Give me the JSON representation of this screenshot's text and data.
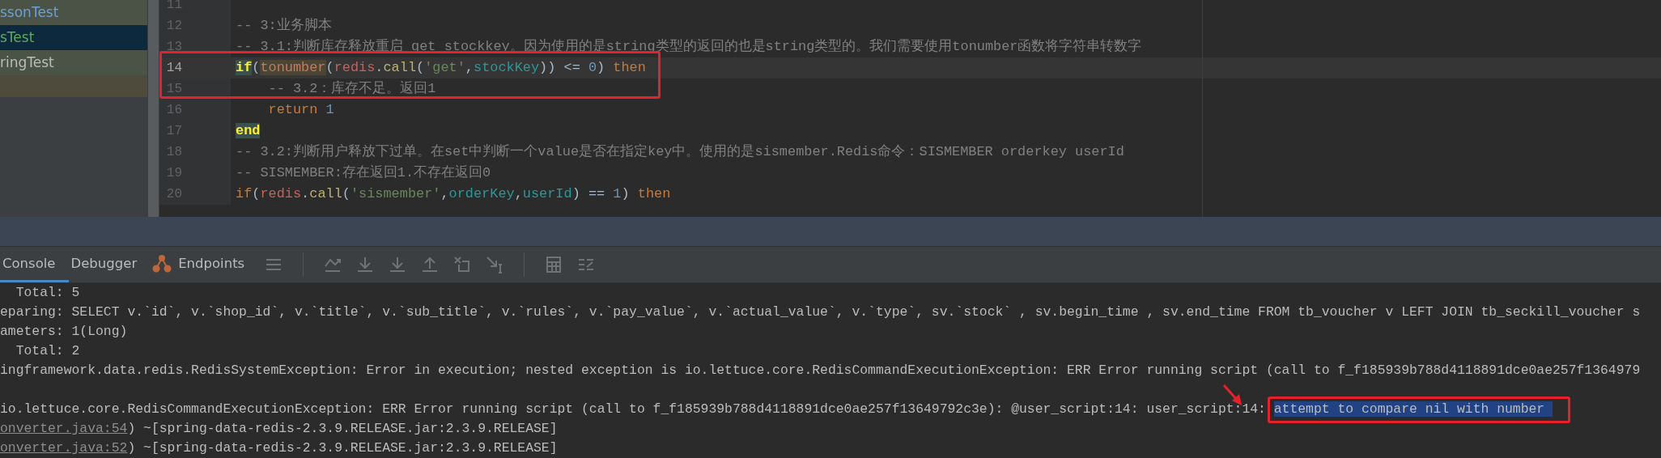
{
  "sidebar": {
    "items": [
      {
        "label": "ssonTest",
        "color": "#6e9fd3",
        "selected": false
      },
      {
        "label": "sTest",
        "color": "#62a85f",
        "selected": true
      },
      {
        "label": "ringTest",
        "color": "#bbbbbb",
        "selected": false
      }
    ]
  },
  "editor": {
    "lines": [
      {
        "number": "11",
        "current": false,
        "boxed": false
      },
      {
        "number": "12",
        "current": false,
        "boxed": false,
        "tokens": [
          {
            "kind": "comment",
            "text": "-- 3:业务脚本"
          }
        ]
      },
      {
        "number": "13",
        "current": false,
        "boxed": false,
        "tokens": [
          {
            "kind": "comment",
            "text": "-- 3.1:判断库存释放重启 get stockkey。因为使用的是string类型的返回的也是string类型的。我们需要使用tonumber函数将字符串转数字"
          }
        ]
      },
      {
        "number": "14",
        "current": true,
        "boxed": true,
        "tokens": [
          {
            "kind": "matched",
            "text": "if"
          },
          {
            "kind": "plain",
            "text": "("
          },
          {
            "kind": "builtin",
            "text": "tonumber"
          },
          {
            "kind": "plain",
            "text": "("
          },
          {
            "kind": "global",
            "text": "redis"
          },
          {
            "kind": "plain",
            "text": "."
          },
          {
            "kind": "method",
            "text": "call"
          },
          {
            "kind": "plain",
            "text": "("
          },
          {
            "kind": "string",
            "text": "'get'"
          },
          {
            "kind": "plain",
            "text": ","
          },
          {
            "kind": "variable",
            "text": "stockKey"
          },
          {
            "kind": "plain",
            "text": ")) <= "
          },
          {
            "kind": "number",
            "text": "0"
          },
          {
            "kind": "plain",
            "text": ") "
          },
          {
            "kind": "keyword",
            "text": "then"
          }
        ]
      },
      {
        "number": "15",
        "current": false,
        "boxed": true,
        "tokens": [
          {
            "kind": "comment",
            "text": "    -- 3.2：库存不足。返回1"
          }
        ]
      },
      {
        "number": "16",
        "current": false,
        "boxed": false,
        "tokens": [
          {
            "kind": "keyword",
            "text": "    return"
          },
          {
            "kind": "number",
            "text": " 1"
          }
        ]
      },
      {
        "number": "17",
        "current": false,
        "boxed": false,
        "tokens": [
          {
            "kind": "matched",
            "text": "end"
          }
        ]
      },
      {
        "number": "18",
        "current": false,
        "boxed": false,
        "tokens": [
          {
            "kind": "comment",
            "text": "-- 3.2:判断用户释放下过单。在set中判断一个value是否在指定key中。使用的是sismember.Redis命令：SISMEMBER orderkey userId"
          }
        ]
      },
      {
        "number": "19",
        "current": false,
        "boxed": false,
        "tokens": [
          {
            "kind": "comment",
            "text": "-- SISMEMBER:存在返回1.不存在返回0"
          }
        ]
      },
      {
        "number": "20",
        "current": false,
        "boxed": false,
        "tokens": [
          {
            "kind": "keyword",
            "text": "if"
          },
          {
            "kind": "plain",
            "text": "("
          },
          {
            "kind": "global",
            "text": "redis"
          },
          {
            "kind": "plain",
            "text": "."
          },
          {
            "kind": "method",
            "text": "call"
          },
          {
            "kind": "plain",
            "text": "("
          },
          {
            "kind": "string",
            "text": "'sismember'"
          },
          {
            "kind": "plain",
            "text": ","
          },
          {
            "kind": "variable",
            "text": "orderKey"
          },
          {
            "kind": "plain",
            "text": ","
          },
          {
            "kind": "variable",
            "text": "userId"
          },
          {
            "kind": "plain",
            "text": ") == "
          },
          {
            "kind": "number",
            "text": "1"
          },
          {
            "kind": "plain",
            "text": ") "
          },
          {
            "kind": "keyword",
            "text": "then"
          }
        ]
      }
    ]
  },
  "tool_window": {
    "tabs": [
      {
        "label": "Console",
        "selected": true,
        "has_icon": false
      },
      {
        "label": "Debugger",
        "selected": false,
        "has_icon": false
      },
      {
        "label": "Endpoints",
        "selected": false,
        "has_icon": true
      }
    ]
  },
  "console": {
    "lines": [
      {
        "kind": "text",
        "segments": [
          {
            "kind": "text",
            "text": "  Total: 5"
          }
        ]
      },
      {
        "kind": "text",
        "segments": [
          {
            "kind": "text",
            "text": "eparing: SELECT v.`id`, v.`shop_id`, v.`title`, v.`sub_title`, v.`rules`, v.`pay_value`, v.`actual_value`, v.`type`, sv.`stock` , sv.begin_time , sv.end_time FROM tb_voucher v LEFT JOIN tb_seckill_voucher s"
          }
        ]
      },
      {
        "kind": "text",
        "segments": [
          {
            "kind": "text",
            "text": "ameters: 1(Long)"
          }
        ]
      },
      {
        "kind": "text",
        "segments": [
          {
            "kind": "text",
            "text": "  Total: 2"
          }
        ]
      },
      {
        "kind": "text",
        "segments": [
          {
            "kind": "text",
            "text": "ingframework.data.redis.RedisSystemException: Error in execution; nested exception is io.lettuce.core.RedisCommandExecutionException: ERR Error running script (call to f_f185939b788d4118891dce0ae257f1364979"
          }
        ]
      },
      {
        "kind": "blank"
      },
      {
        "kind": "text",
        "segments": [
          {
            "kind": "text",
            "text": "io.lettuce.core.RedisCommandExecutionException: ERR Error running script (call to f_f185939b788d4118891dce0ae257f13649792c3e): @user_script:14: user_script:14: ",
            "arrow": true
          },
          {
            "kind": "text",
            "text": "attempt to compare nil with number ",
            "selected": true,
            "boxed": true
          }
        ]
      },
      {
        "kind": "text",
        "segments": [
          {
            "kind": "link",
            "text": "onverter.java:54"
          },
          {
            "kind": "text",
            "text": ") ~[spring-data-redis-2.3.9.RELEASE.jar:2.3.9.RELEASE]"
          }
        ]
      },
      {
        "kind": "text",
        "segments": [
          {
            "kind": "link",
            "text": "onverter.java:52"
          },
          {
            "kind": "text",
            "text": ") ~[spring-data-redis-2.3.9.RELEASE.jar:2.3.9.RELEASE]"
          }
        ]
      }
    ]
  }
}
